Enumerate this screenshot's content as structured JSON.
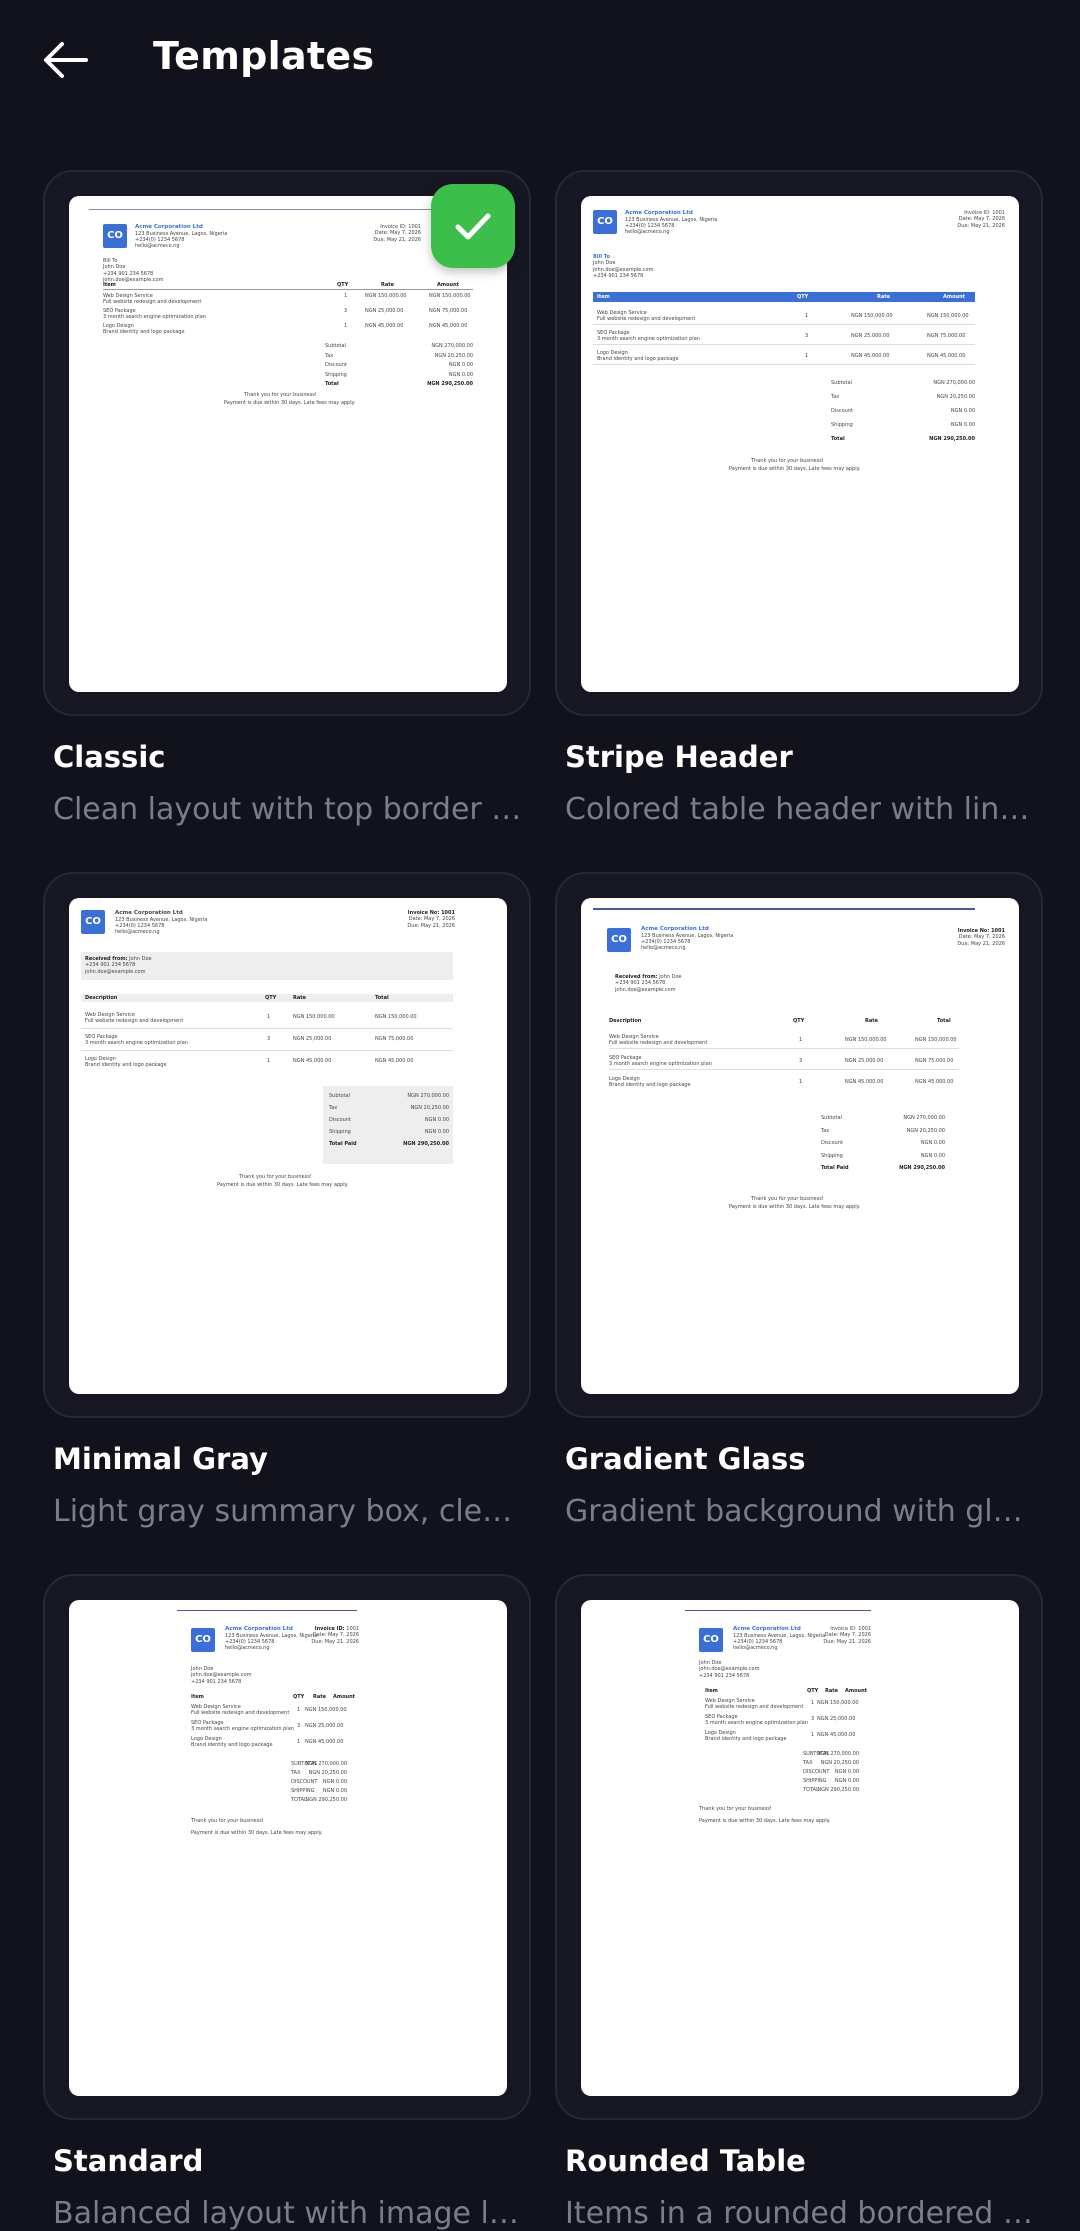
{
  "header": {
    "title": "Templates"
  },
  "invoice": {
    "logo": "CO",
    "company": "Acme Corporation Ltd",
    "address": "123 Business Avenue, Lagos, Nigeria",
    "phone": "+234(0) 1234 5678",
    "email": "hello@acmeco.ng",
    "invoice_label": "Invoice ID:",
    "invoice_no": "1001",
    "date_label": "Date:",
    "date": "May 7, 2026",
    "due_label": "Due:",
    "due": "May 21, 2026",
    "bill_to": "Bill To",
    "received_from": "Received from:",
    "client": "John Doe",
    "client_phone": "+234 901 234 5678",
    "client_email": "john.doe@example.com",
    "cols": {
      "item": "Item",
      "qty": "QTY",
      "rate": "Rate",
      "amount": "Amount",
      "description": "Description",
      "total": "Total"
    },
    "items": [
      {
        "name": "Web Design Service",
        "desc": "Full website redesign and development",
        "qty": "1",
        "rate": "NGN 150,000.00",
        "amount": "NGN 150,000.00"
      },
      {
        "name": "SEO Package",
        "desc": "3 month search engine optimization plan",
        "qty": "3",
        "rate": "NGN 25,000.00",
        "amount": "NGN 75,000.00"
      },
      {
        "name": "Logo Design",
        "desc": "Brand identity and logo package",
        "qty": "1",
        "rate": "NGN 45,000.00",
        "amount": "NGN 45,000.00"
      }
    ],
    "summary": [
      {
        "label": "Subtotal",
        "value": "NGN 270,000.00"
      },
      {
        "label": "Tax",
        "value": "NGN 20,250.00"
      },
      {
        "label": "Discount",
        "value": "NGN 0.00"
      },
      {
        "label": "Shipping",
        "value": "NGN 0.00"
      },
      {
        "label": "Total",
        "value": "NGN 290,250.00"
      }
    ],
    "thanks": "Thank you for your business!",
    "terms": "Payment is due within 30 days. Late fees may apply."
  },
  "templates": [
    {
      "name": "Classic",
      "description": "Clean layout with top border accent",
      "selected": true
    },
    {
      "name": "Stripe Header",
      "description": "Colored table header with line items"
    },
    {
      "name": "Minimal Gray",
      "description": "Light gray summary box, clean lines"
    },
    {
      "name": "Gradient Glass",
      "description": "Gradient background with glass effect"
    },
    {
      "name": "Standard",
      "description": "Balanced layout with image logo"
    },
    {
      "name": "Rounded Table",
      "description": "Items in a rounded bordered table"
    }
  ]
}
